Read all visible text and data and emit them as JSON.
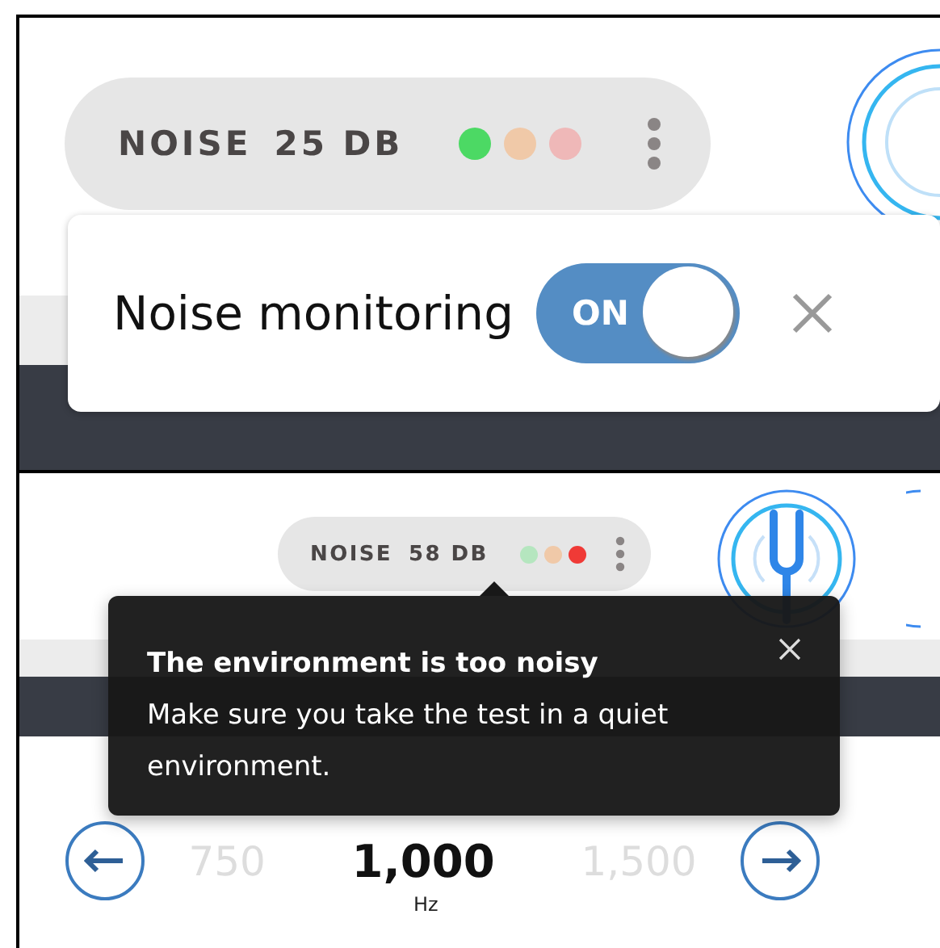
{
  "panels": [
    {
      "noise_indicator": {
        "label": "NOISE",
        "reading": "25 DB",
        "dots": [
          {
            "color": "#4cd964"
          },
          {
            "color": "#f0c9a8"
          },
          {
            "color": "#efb8b8"
          }
        ]
      },
      "popup": {
        "label": "Noise monitoring",
        "toggle": {
          "text": "ON",
          "on": true
        }
      }
    },
    {
      "noise_indicator": {
        "label": "NOISE",
        "reading": "58 DB",
        "dots": [
          {
            "color": "#b5e6bf"
          },
          {
            "color": "#f0c9a8"
          },
          {
            "color": "#f03a36"
          }
        ]
      },
      "tooltip": {
        "title": "The environment is too noisy",
        "message": "Make sure you take the test in a quiet environment."
      },
      "frequency_selector": {
        "options": [
          {
            "label": "750",
            "selected": false
          },
          {
            "label": "1,000",
            "selected": true
          },
          {
            "label": "1,500",
            "selected": false
          }
        ],
        "unit": "Hz"
      }
    }
  ]
}
